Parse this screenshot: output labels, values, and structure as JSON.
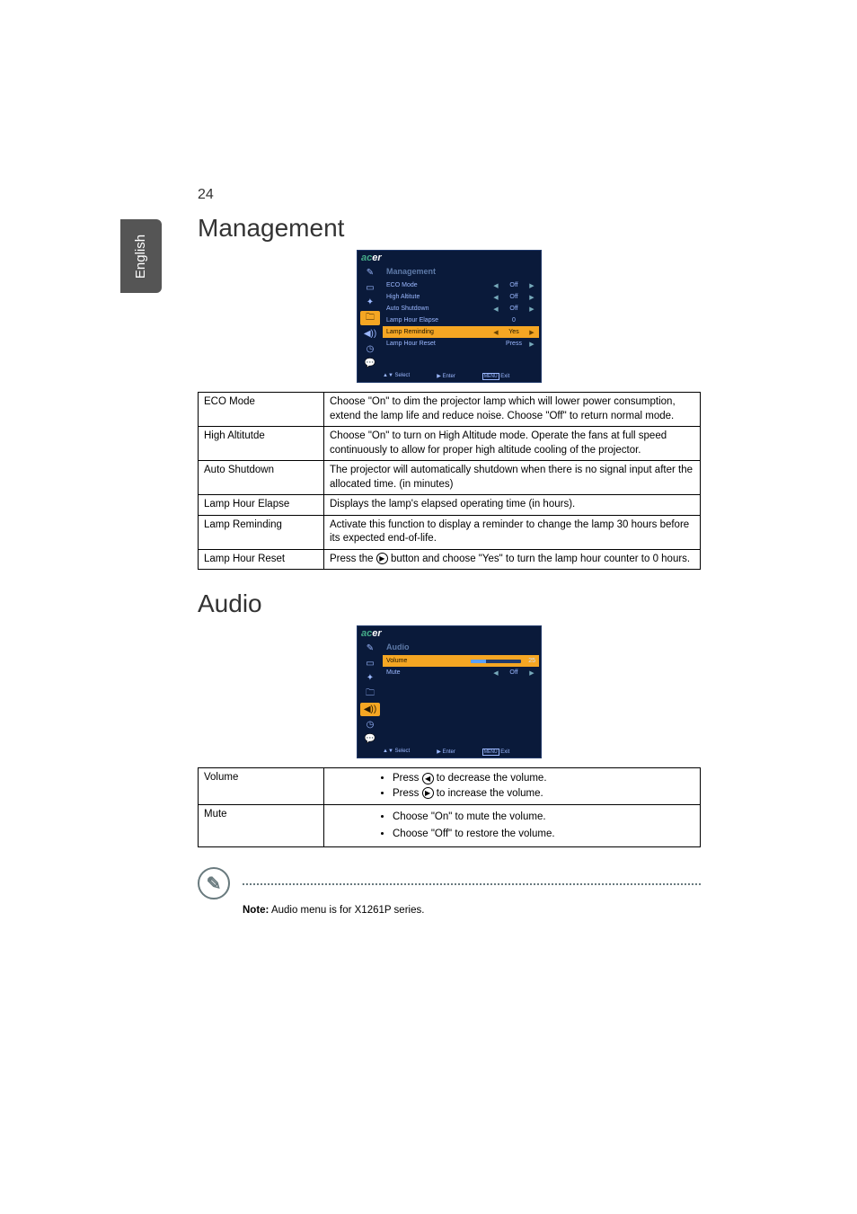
{
  "page_number": "24",
  "language_tab": "English",
  "brand": "acer",
  "sections": {
    "management": {
      "title": "Management",
      "osd_heading": "Management",
      "osd_rows": [
        {
          "label": "ECO Mode",
          "value": "Off"
        },
        {
          "label": "High Altitute",
          "value": "Off"
        },
        {
          "label": "Auto Shutdown",
          "value": "Off"
        },
        {
          "label": "Lamp Hour Elapse",
          "value": "0"
        },
        {
          "label": "Lamp Reminding",
          "value": "Yes"
        },
        {
          "label": "Lamp Hour Reset",
          "value": "Press"
        }
      ],
      "footer": {
        "select": "Select",
        "enter": "Enter",
        "exit": "Exit",
        "menu": "MENU"
      },
      "table": {
        "eco_mode": {
          "label": "ECO Mode",
          "desc": "Choose \"On\" to dim the projector lamp which will lower power consumption, extend the lamp life and reduce noise. Choose \"Off\" to return normal mode."
        },
        "high_altitude": {
          "label": "High Altitutde",
          "desc": "Choose \"On\" to turn on High Altitude mode. Operate the fans at full speed continuously to allow for proper high altitude cooling of the projector."
        },
        "auto_shutdown": {
          "label": "Auto Shutdown",
          "desc": "The projector will automatically shutdown when there is no signal input after the allocated time. (in minutes)"
        },
        "lamp_hour_elapse": {
          "label": "Lamp Hour Elapse",
          "desc": "Displays the lamp's elapsed operating time (in hours)."
        },
        "lamp_reminding": {
          "label": "Lamp Reminding",
          "desc": "Activate this function to display a reminder to change the lamp 30 hours before its expected end-of-life."
        },
        "lamp_hour_reset": {
          "label": "Lamp Hour Reset",
          "desc_pre": "Press the ",
          "desc_post": " button and choose \"Yes\" to turn the lamp hour counter to 0 hours."
        }
      }
    },
    "audio": {
      "title": "Audio",
      "osd_heading": "Audio",
      "osd_rows": {
        "volume": {
          "label": "Volume",
          "value": "25"
        },
        "mute": {
          "label": "Mute",
          "value": "Off"
        }
      },
      "footer": {
        "select": "Select",
        "enter": "Enter",
        "exit": "Exit",
        "menu": "MENU"
      },
      "table": {
        "volume": {
          "label": "Volume",
          "dec_pre": "Press ",
          "dec_post": " to decrease the volume.",
          "inc_pre": "Press ",
          "inc_post": " to increase the volume."
        },
        "mute": {
          "label": "Mute",
          "on": "Choose \"On\" to mute the volume.",
          "off": "Choose \"Off\" to restore the volume."
        }
      },
      "note": {
        "label": "Note:",
        "text": " Audio menu is for X1261P series."
      }
    }
  }
}
